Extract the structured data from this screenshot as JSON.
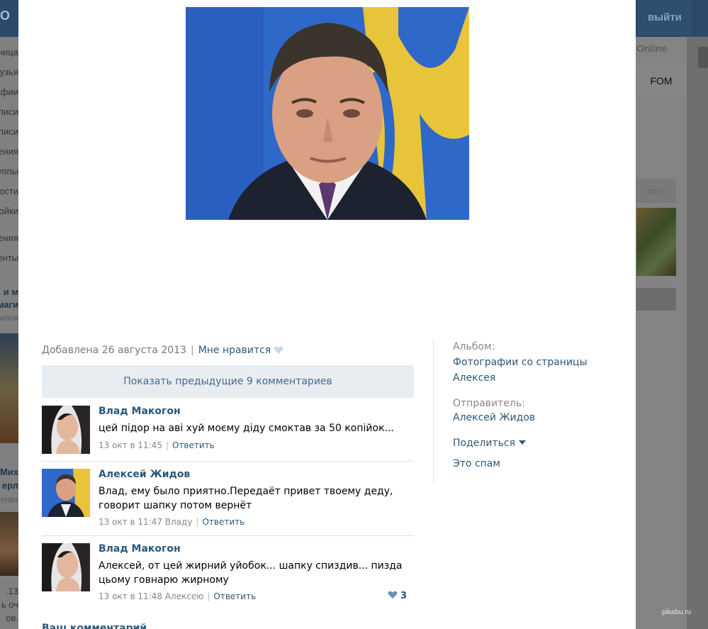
{
  "background": {
    "logo": "O",
    "exit_button": "выйти",
    "left_menu": [
      "Моя Страница",
      "Мои Друзья",
      "Мои Фотографии",
      "Мои Видеозаписи",
      "Мои Аудиозаписи",
      "Мои Сообщения",
      "Мои Группы",
      "Мои Новости",
      "Мои Настройки",
      "Приложения",
      "Документы"
    ],
    "online": "Online",
    "fom": "FOM",
    "all": "все",
    "fragments": [
      "и м",
      "маги",
      "илож",
      "Мих",
      "ерл",
      "enter",
      ".13",
      "ь оч",
      "ов."
    ]
  },
  "photo": {
    "description": "portrait photo"
  },
  "meta": {
    "added": "Добавлена 26 августа 2013",
    "separator": "|",
    "like": "Мне нравится"
  },
  "show_previous": "Показать предыдущие 9 комментариев",
  "comments": [
    {
      "author": "Влад Макогон",
      "text": "цей підор на аві хуй моєму діду смоктав за 50 копійок...",
      "time": "13 окт в 11:45",
      "separator": "|",
      "reply": "Ответить"
    },
    {
      "author": "Алексей Жидов",
      "text": "Влад, ему было приятно.Передаёт привет твоему деду, говорит шапку потом вернёт",
      "time": "13 окт в 11:47 Владу",
      "separator": "|",
      "reply": "Ответить"
    },
    {
      "author": "Влад Макогон",
      "text": "Алексей, от цей жирний уйобок... шапку спиздив... пизда цьому говнарю жирному",
      "time": "13 окт в 11:48 Алексею",
      "separator": "|",
      "reply": "Ответить",
      "likes": "3"
    }
  ],
  "next_partial": "Ваш комментарий",
  "sidebar": {
    "album_label": "Альбом:",
    "album_line1": "Фотографии со страницы",
    "album_line2": "Алексея",
    "sender_label": "Отправитель:",
    "sender": "Алексей Жидов",
    "share": "Поделиться",
    "spam": "Это спам"
  },
  "watermark": "pikabu.ru",
  "colors": {
    "link": "#2b587a",
    "header": "#2b4a6b",
    "show_prev_bg": "#e8edf1"
  }
}
